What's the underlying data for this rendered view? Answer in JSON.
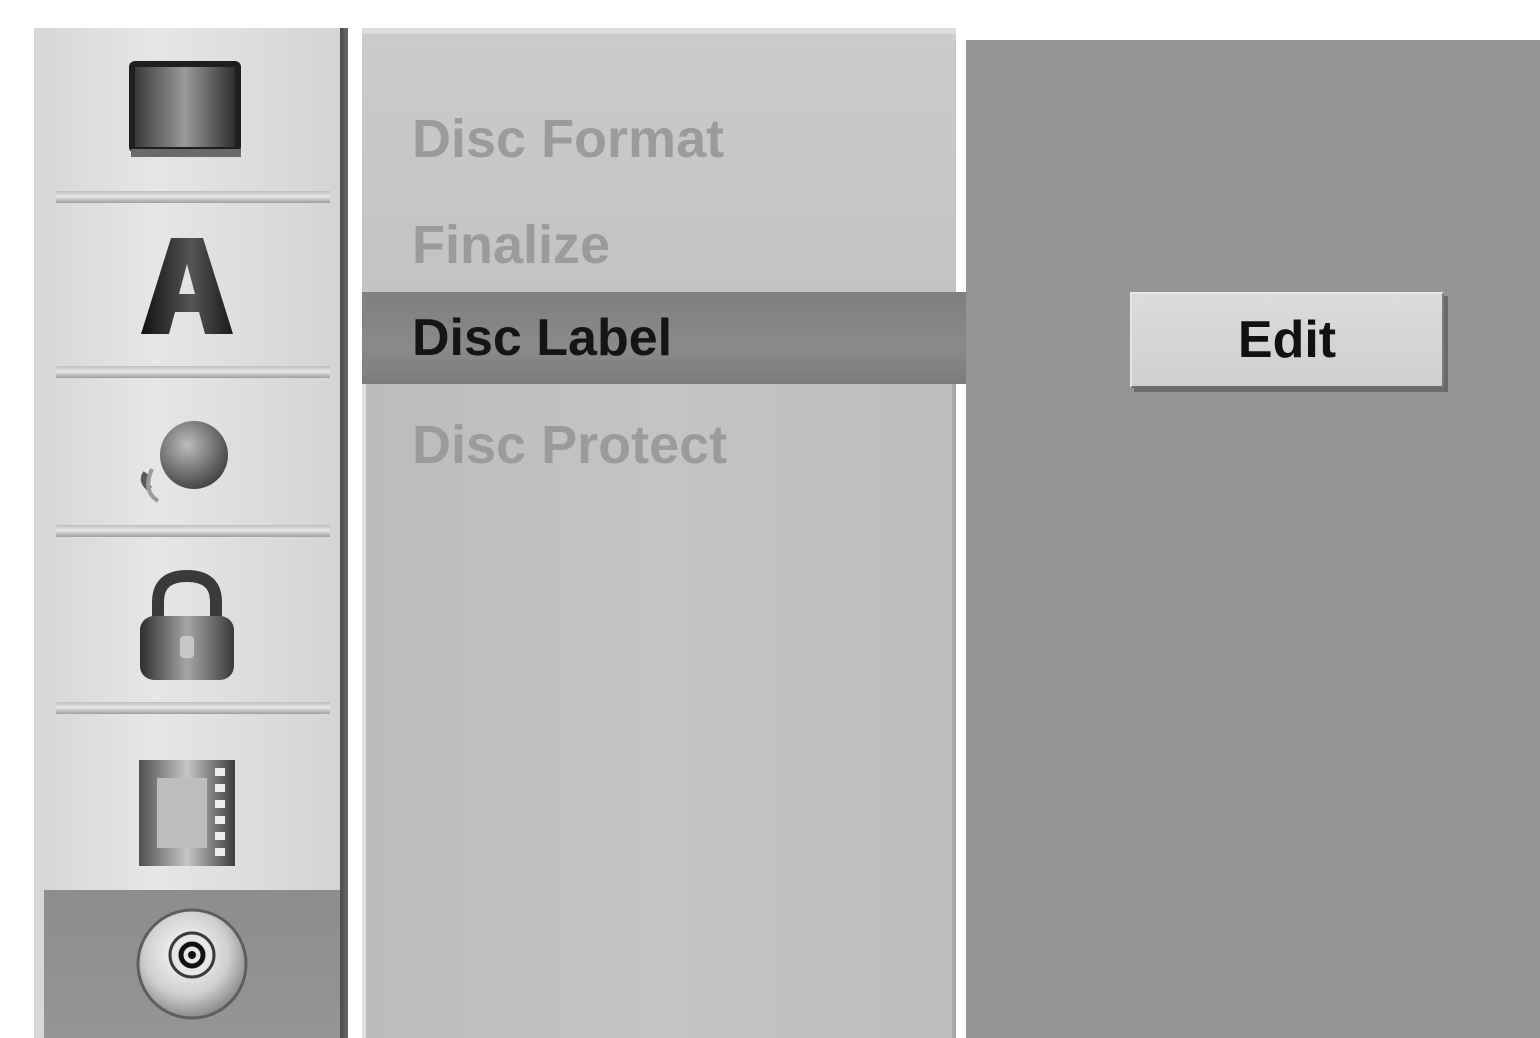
{
  "sidebar": {
    "icons": [
      {
        "name": "tv-screen-icon",
        "selected": false
      },
      {
        "name": "language-letter-a-icon",
        "selected": false
      },
      {
        "name": "audio-speaker-icon",
        "selected": false
      },
      {
        "name": "padlock-icon",
        "selected": false
      },
      {
        "name": "film-strip-icon",
        "selected": false
      },
      {
        "name": "disc-icon",
        "selected": true
      }
    ]
  },
  "menu": {
    "items": [
      {
        "label": "Disc Format"
      },
      {
        "label": "Finalize"
      },
      {
        "label": "Disc Label"
      },
      {
        "label": "Disc Protect"
      }
    ],
    "selected_index": 2
  },
  "content": {
    "edit_label": "Edit"
  },
  "colors": {
    "panel_light": "#c4c4c4",
    "highlight": "#858585",
    "content_bg": "#959595",
    "inactive_text": "#9b9b9b",
    "active_text": "#151515"
  }
}
